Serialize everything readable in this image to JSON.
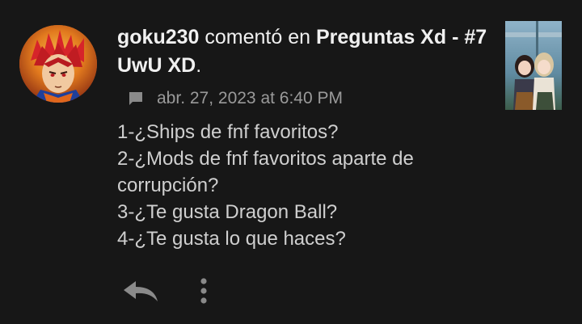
{
  "comment": {
    "username": "goku230",
    "action_text": "comentó en",
    "post_title": "Preguntas Xd - #7 UwU XD",
    "post_suffix": ".",
    "timestamp": "abr. 27, 2023 at 6:40 PM",
    "lines": [
      "1-¿Ships de fnf favoritos?",
      "2-¿Mods de fnf favoritos aparte de corrupción?",
      "3-¿Te gusta Dragon Ball?",
      "4-¿Te gusta lo que haces?"
    ]
  },
  "icons": {
    "timestamp_icon": "comment-bubble-icon",
    "reply": "reply-arrow-icon",
    "more": "more-vertical-icon"
  },
  "colors": {
    "background": "#171717",
    "text_primary": "#f0f0f0",
    "text_secondary": "#9a9a9a",
    "body_text": "#cfcfcf"
  }
}
